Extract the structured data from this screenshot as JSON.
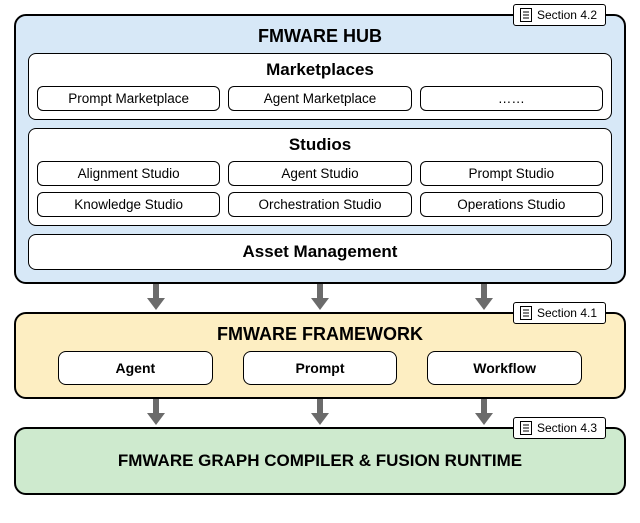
{
  "hub": {
    "title": "FMWARE HUB",
    "section_label": "Section 4.2",
    "marketplaces": {
      "title": "Marketplaces",
      "items": [
        "Prompt Marketplace",
        "Agent Marketplace",
        "……"
      ]
    },
    "studios": {
      "title": "Studios",
      "row1": [
        "Alignment Studio",
        "Agent Studio",
        "Prompt Studio"
      ],
      "row2": [
        "Knowledge Studio",
        "Orchestration Studio",
        "Operations Studio"
      ]
    },
    "asset_management": "Asset Management"
  },
  "framework": {
    "title": "FMWARE FRAMEWORK",
    "section_label": "Section 4.1",
    "items": [
      "Agent",
      "Prompt",
      "Workflow"
    ]
  },
  "runtime": {
    "title": "FMWARE GRAPH COMPILER & FUSION RUNTIME",
    "section_label": "Section 4.3"
  }
}
